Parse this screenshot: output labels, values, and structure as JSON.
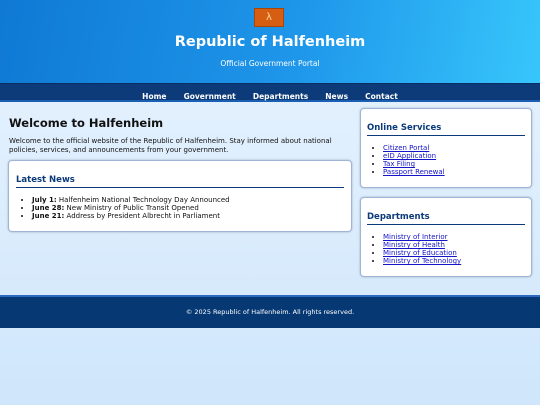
{
  "header": {
    "emblem_glyph": "λ",
    "title": "Republic of Halfenheim",
    "subtitle": "Official Government Portal"
  },
  "nav": {
    "items": [
      "Home",
      "Government",
      "Departments",
      "News",
      "Contact"
    ]
  },
  "main": {
    "title": "Welcome to Halfenheim",
    "intro": "Welcome to the official website of the Republic of Halfenheim. Stay informed about national policies, services, and announcements from your government."
  },
  "news": {
    "title": "Latest News",
    "items": [
      {
        "date": "July 1:",
        "text": " Halfenheim National Technology Day Announced"
      },
      {
        "date": "June 28:",
        "text": " New Ministry of Public Transit Opened"
      },
      {
        "date": "June 21:",
        "text": " Address by President Albrecht in Parliament"
      }
    ]
  },
  "services": {
    "title": "Online Services",
    "links": [
      "Citizen Portal",
      "eID Application",
      "Tax Filing",
      "Passport Renewal"
    ]
  },
  "departments": {
    "title": "Departments",
    "links": [
      "Ministry of Interior",
      "Ministry of Health",
      "Ministry of Education",
      "Ministry of Technology"
    ]
  },
  "footer": {
    "text": "© 2025 Republic of Halfenheim. All rights reserved."
  },
  "colors": {
    "header_start": "#0f79d4",
    "header_end": "#37c6fb",
    "nav_bg": "#0d3a78",
    "footer_bg": "#063873",
    "section_heading": "#0b3a7a",
    "link": "#1414c8",
    "emblem": "#d65e12"
  }
}
